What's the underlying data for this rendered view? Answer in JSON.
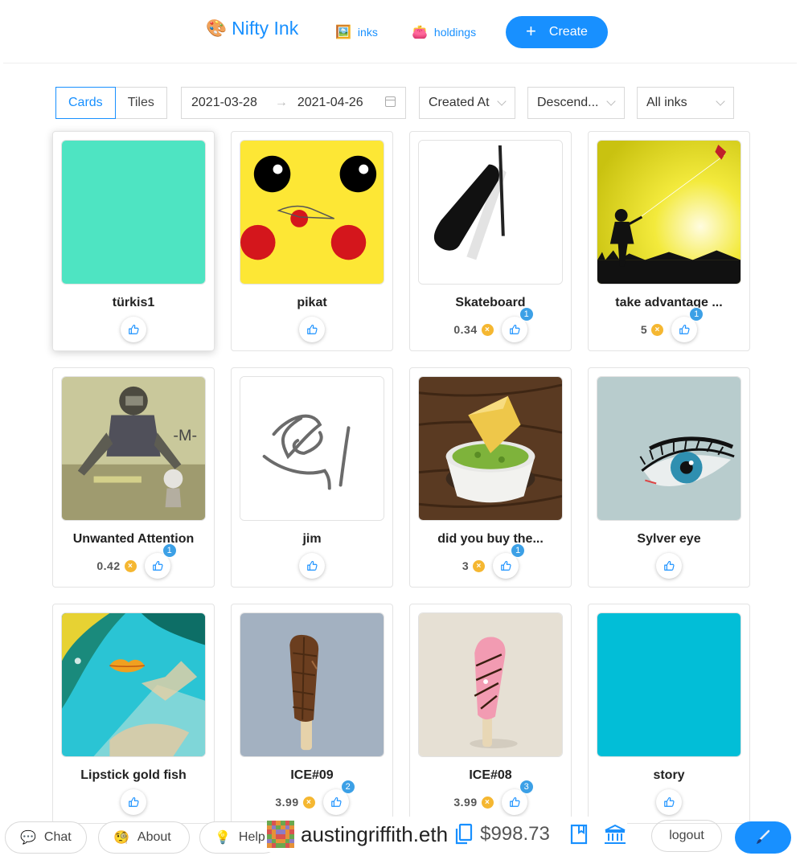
{
  "header": {
    "logo_emoji": "🎨",
    "logo_text": "Nifty Ink",
    "nav": [
      {
        "emoji": "🖼️",
        "label": "inks"
      },
      {
        "emoji": "👛",
        "label": "holdings"
      }
    ],
    "create_label": "Create",
    "create_icon": "+"
  },
  "filters": {
    "view_modes": [
      "Cards",
      "Tiles"
    ],
    "active_view": "Cards",
    "date_start": "2021-03-28",
    "date_end": "2021-04-26",
    "date_separator": "→",
    "sort_field": "Created At",
    "sort_order": "Descend...",
    "ink_filter": "All inks"
  },
  "cards": [
    {
      "title": "türkis1",
      "price": "",
      "likes": ""
    },
    {
      "title": "pikat",
      "price": "",
      "likes": ""
    },
    {
      "title": "Skateboard",
      "price": "0.34",
      "likes": "1"
    },
    {
      "title": "take advantage ...",
      "price": "5",
      "likes": "1"
    },
    {
      "title": "Unwanted Attention",
      "price": "0.42",
      "likes": "1"
    },
    {
      "title": "jim",
      "price": "",
      "likes": ""
    },
    {
      "title": "did you buy the...",
      "price": "3",
      "likes": "1"
    },
    {
      "title": "Sylver eye",
      "price": "",
      "likes": ""
    },
    {
      "title": "Lipstick gold fish",
      "price": "",
      "likes": ""
    },
    {
      "title": "ICE#09",
      "price": "3.99",
      "likes": "2"
    },
    {
      "title": "ICE#08",
      "price": "3.99",
      "likes": "3"
    },
    {
      "title": "story",
      "price": "",
      "likes": ""
    }
  ],
  "currency_icon": "xdai-coin-icon",
  "currency_glyph": "×",
  "bottom": {
    "chat": {
      "emoji": "💬",
      "label": "Chat"
    },
    "about": {
      "emoji": "🧐",
      "label": "About"
    },
    "help": {
      "emoji": "💡",
      "label": "Help"
    },
    "account_name": "austingriffith.eth",
    "balance": "$998.73",
    "logout_label": "logout"
  },
  "colors": {
    "brand": "#1890ff",
    "badge": "#3ca0e6",
    "coin": "#f5b731"
  }
}
